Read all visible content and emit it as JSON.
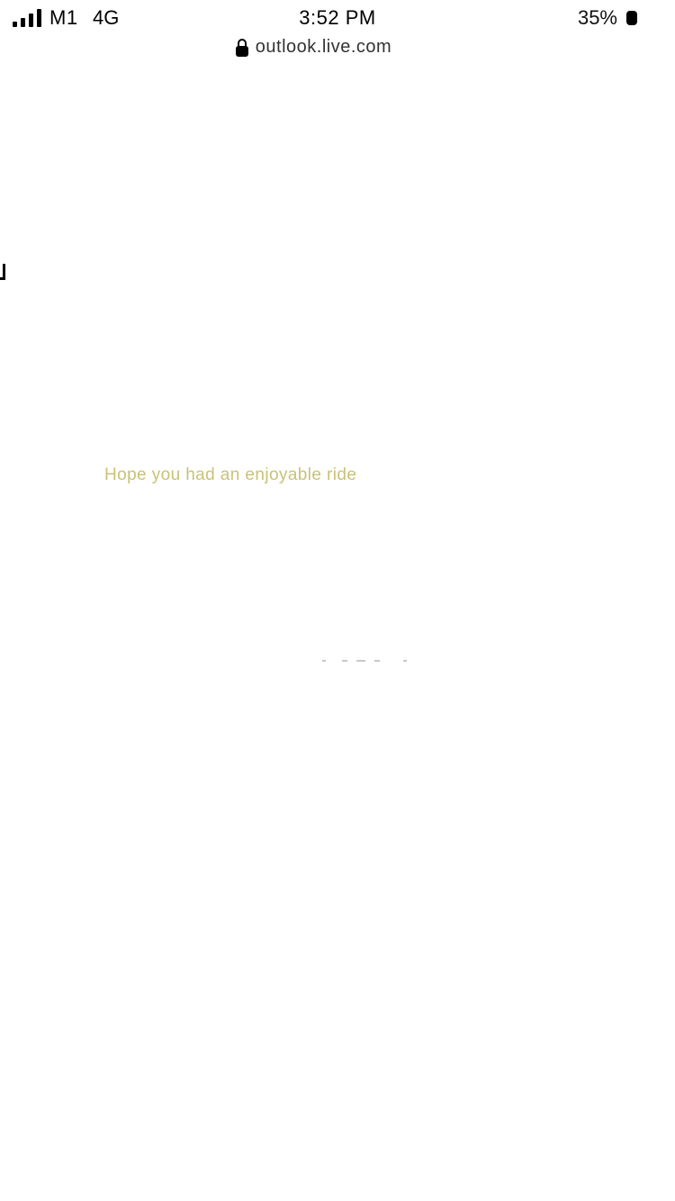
{
  "status_bar": {
    "carrier": "M1",
    "network": "4G",
    "time": "3:52 PM",
    "battery_percent": "35%",
    "signal_bars": 4
  },
  "browser": {
    "url": "outlook.live.com",
    "secure_icon": "lock-icon"
  },
  "page": {
    "message": "Hope you had an enjoyable ride"
  },
  "colors": {
    "background": "#ffffff",
    "message_text": "#c9c277"
  }
}
